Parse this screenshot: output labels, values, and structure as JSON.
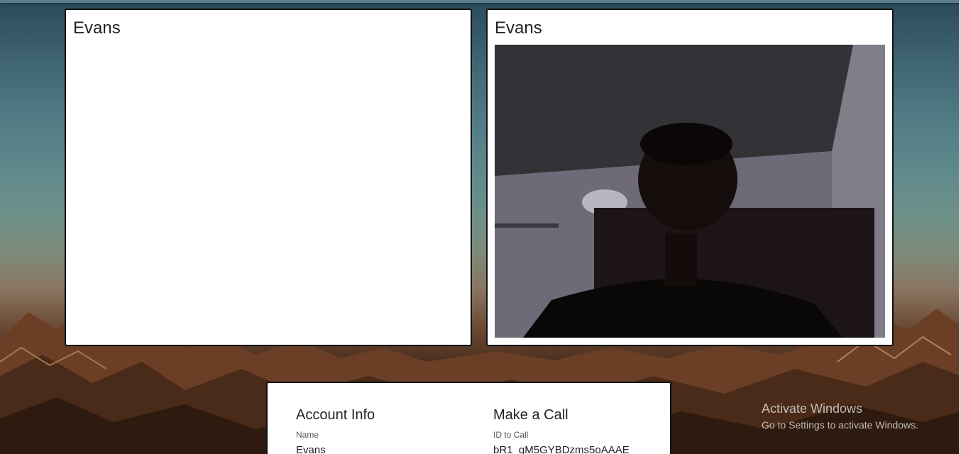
{
  "video_cards": {
    "local": {
      "name": "Evans"
    },
    "remote": {
      "name": "Evans"
    }
  },
  "account_info": {
    "title": "Account Info",
    "name_label": "Name",
    "name_value": "Evans"
  },
  "make_call": {
    "title": "Make a Call",
    "id_label": "ID to Call",
    "id_value": "bR1_gM5GYBDzms5oAAAE"
  },
  "watermark": {
    "title": "Activate Windows",
    "subtitle": "Go to Settings to activate Windows."
  },
  "colors": {
    "card_border": "#111111",
    "card_bg": "#ffffff",
    "text": "#222222"
  }
}
